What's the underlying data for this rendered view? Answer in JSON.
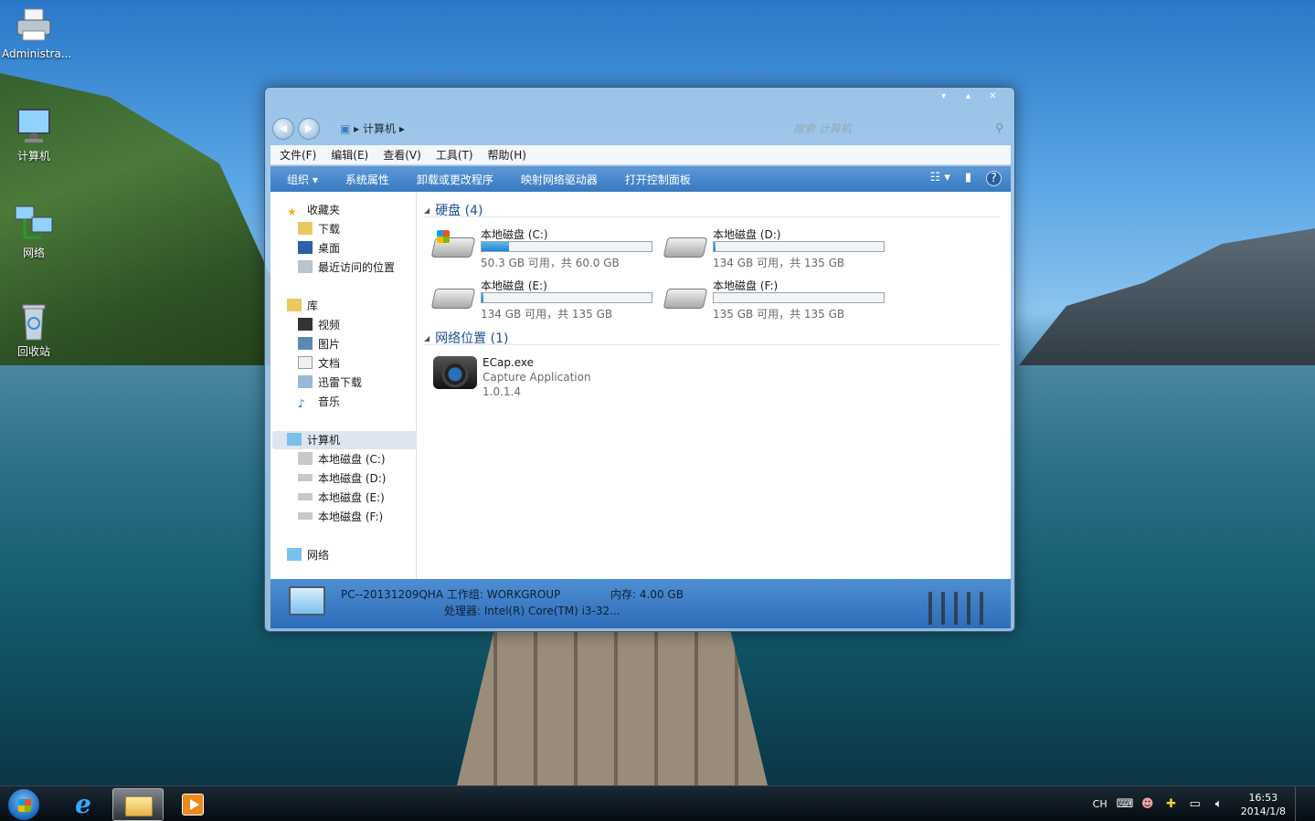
{
  "desktop": {
    "icons": [
      {
        "label": "Administra...",
        "icon": "printer-icon"
      },
      {
        "label": "计算机",
        "icon": "computer-icon"
      },
      {
        "label": "网络",
        "icon": "network-icon"
      },
      {
        "label": "回收站",
        "icon": "recycle-bin-icon"
      }
    ]
  },
  "window": {
    "breadcrumb": "计算机",
    "search_placeholder": "搜索 计算机",
    "caption": {
      "minimize": "▾",
      "maximize": "▴",
      "close": "✕"
    },
    "menu": [
      "文件(F)",
      "编辑(E)",
      "查看(V)",
      "工具(T)",
      "帮助(H)"
    ],
    "toolbar": [
      "组织 ▾",
      "系统属性",
      "卸载或更改程序",
      "映射网络驱动器",
      "打开控制面板"
    ],
    "nav": {
      "favorites": "收藏夹",
      "fav_items": [
        "下载",
        "桌面",
        "最近访问的位置"
      ],
      "libraries": "库",
      "lib_items": [
        "视频",
        "图片",
        "文档",
        "迅雷下载",
        "音乐"
      ],
      "computer": "计算机",
      "computer_items": [
        "本地磁盘 (C:)",
        "本地磁盘 (D:)",
        "本地磁盘 (E:)",
        "本地磁盘 (F:)"
      ],
      "network": "网络"
    },
    "groups": {
      "hdd": "硬盘 (4)",
      "network": "网络位置 (1)"
    },
    "drives": [
      {
        "name": "本地磁盘 (C:)",
        "free_text": "50.3 GB 可用，共 60.0 GB",
        "used_fraction": 0.16
      },
      {
        "name": "本地磁盘 (D:)",
        "free_text": "134 GB 可用，共 135 GB",
        "used_fraction": 0.01
      },
      {
        "name": "本地磁盘 (E:)",
        "free_text": "134 GB 可用，共 135 GB",
        "used_fraction": 0.01
      },
      {
        "name": "本地磁盘 (F:)",
        "free_text": "135 GB 可用，共 135 GB",
        "used_fraction": 0.0
      }
    ],
    "network_item": {
      "name": "ECap.exe",
      "description": "Capture Application",
      "version": "1.0.1.4"
    },
    "details": {
      "pc_line": "PC--20131209QHA  工作组: WORKGROUP",
      "cpu_line": "处理器: Intel(R) Core(TM) i3-32...",
      "memory_line": "内存: 4.00 GB"
    }
  },
  "taskbar": {
    "lang": "CH",
    "time": "16:53",
    "date": "2014/1/8"
  }
}
